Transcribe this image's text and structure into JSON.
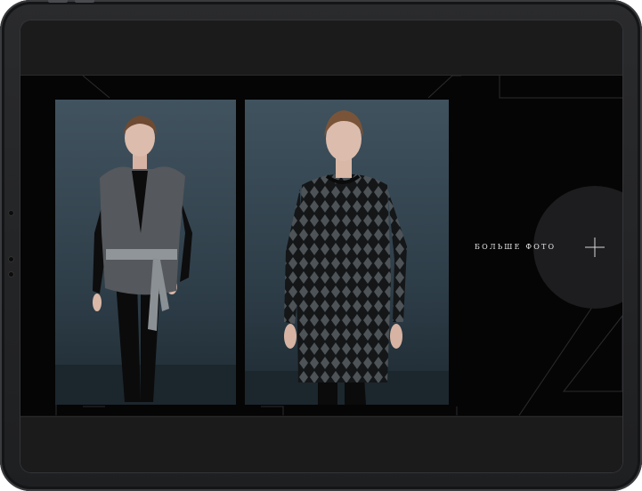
{
  "gallery": {
    "more_photos_label": "БОЛЬШЕ ФОТО",
    "more_icon": "plus-icon",
    "photos": [
      {
        "description_icon": "model-in-fur-vest-photo"
      },
      {
        "description_icon": "model-in-diamond-knit-dress-photo"
      }
    ]
  },
  "colors": {
    "background": "#050505",
    "accent_circle": "#1d1d1f",
    "text": "#e8e8e8"
  }
}
